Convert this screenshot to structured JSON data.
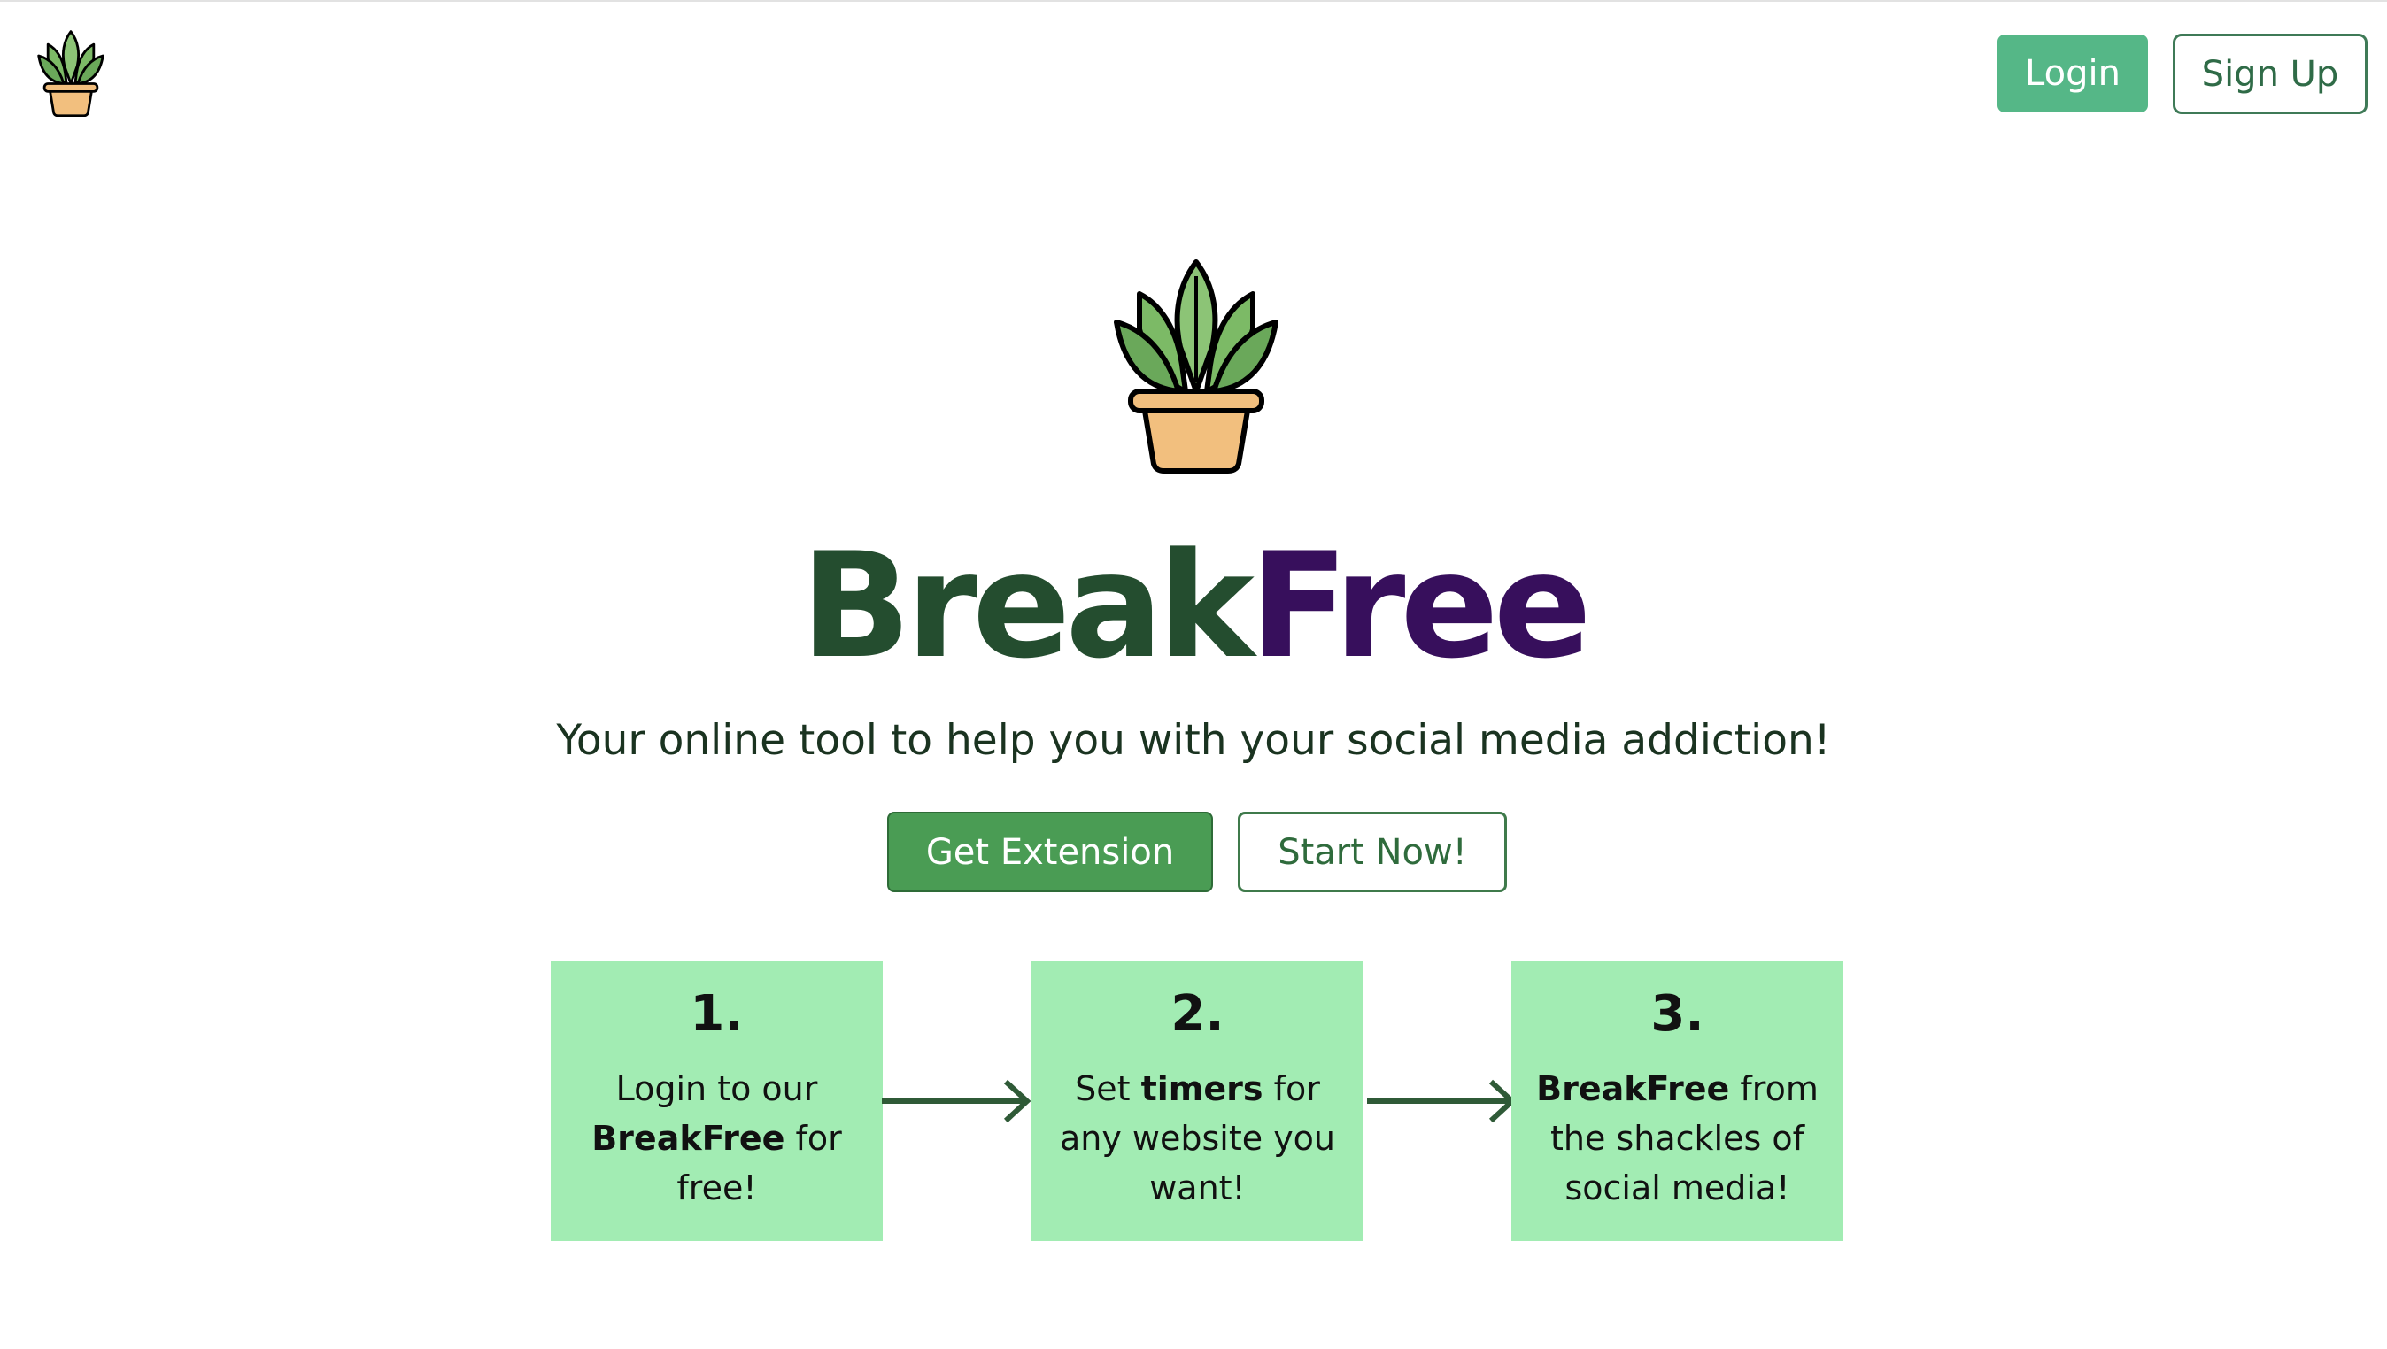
{
  "header": {
    "logo_icon": "potted-plant-icon",
    "login_label": "Login",
    "signup_label": "Sign Up"
  },
  "hero": {
    "logo_icon": "potted-plant-icon",
    "title_part1": "Break",
    "title_part2": "Free",
    "title_colors": {
      "part1": "#244d2f",
      "part2": "#370f5c"
    },
    "tagline": "Your online tool to help you with your social media addiction!",
    "get_extension_label": "Get Extension",
    "start_now_label": "Start Now!"
  },
  "steps": [
    {
      "number": "1.",
      "text_before": "Login to our",
      "text_bold": "BreakFree",
      "text_after": "for free!"
    },
    {
      "number": "2.",
      "text_before": "Set",
      "text_bold": "timers",
      "text_after": "for any website you want!"
    },
    {
      "number": "3.",
      "text_before": "",
      "text_bold": "BreakFree",
      "text_after": "from the shackles of social media!"
    }
  ],
  "arrows": [
    "arrow-right-icon",
    "arrow-right-icon"
  ],
  "colors": {
    "accent_green": "#55b787",
    "button_green": "#4a9c54",
    "step_bg": "#a2ecb3"
  }
}
